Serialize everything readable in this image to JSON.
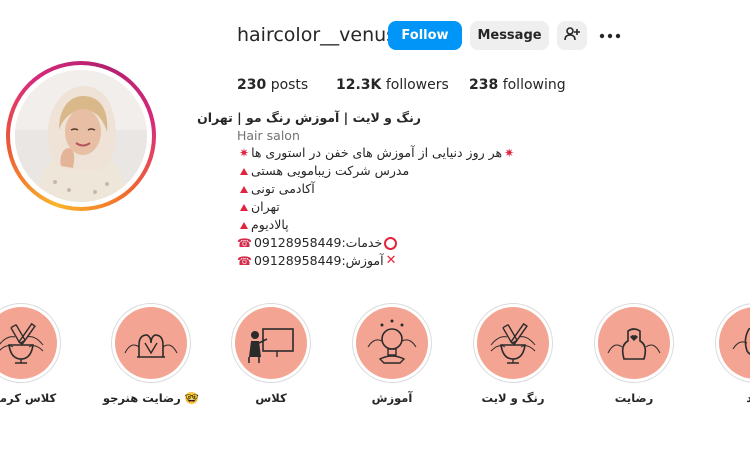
{
  "profile": {
    "username": "haircolor__venus",
    "follow_label": "Follow",
    "message_label": "Message",
    "add_user_icon": "add-user-icon",
    "more_icon": "more-options-icon"
  },
  "stats": {
    "posts_count": "230",
    "posts_label": "posts",
    "followers_count": "12.3K",
    "followers_label": "followers",
    "following_count": "238",
    "following_label": "following"
  },
  "bio": {
    "title": "رنگ و لایت | آموزش رنگ مو | تهران",
    "category": "Hair salon",
    "line1": "هر روز دنیایی از آموزش های خفن در استوری ها",
    "line2": "مدرس شرکت زیبامویی هستی",
    "line3": "آکادمی تونی",
    "line4": "تهران",
    "line5": "پالادیوم",
    "line6_label": "خدمات:",
    "line6_phone": "09128958449",
    "line7_label": "آموزش:",
    "line7_phone": "09128958449"
  },
  "highlights": [
    {
      "label": "کلاس کرمان",
      "icon": "hair-dye-bowl-icon"
    },
    {
      "label": "رضایت هنرجو 🤓",
      "icon": "heart-hands-icon"
    },
    {
      "label": "کلاس",
      "icon": "teacher-board-icon"
    },
    {
      "label": "آموزش",
      "icon": "lightbulb-idea-icon"
    },
    {
      "label": "رنگ و لایت",
      "icon": "hair-dye-bowl-icon"
    },
    {
      "label": "رضایت",
      "icon": "heart-hands-icon"
    },
    {
      "label": "بعد",
      "icon": "face-icon"
    }
  ],
  "colors": {
    "follow_blue": "#0095f6",
    "highlight_fill": "#f4a492",
    "emoji_red": "#e0243b",
    "secondary_text": "#737373"
  }
}
